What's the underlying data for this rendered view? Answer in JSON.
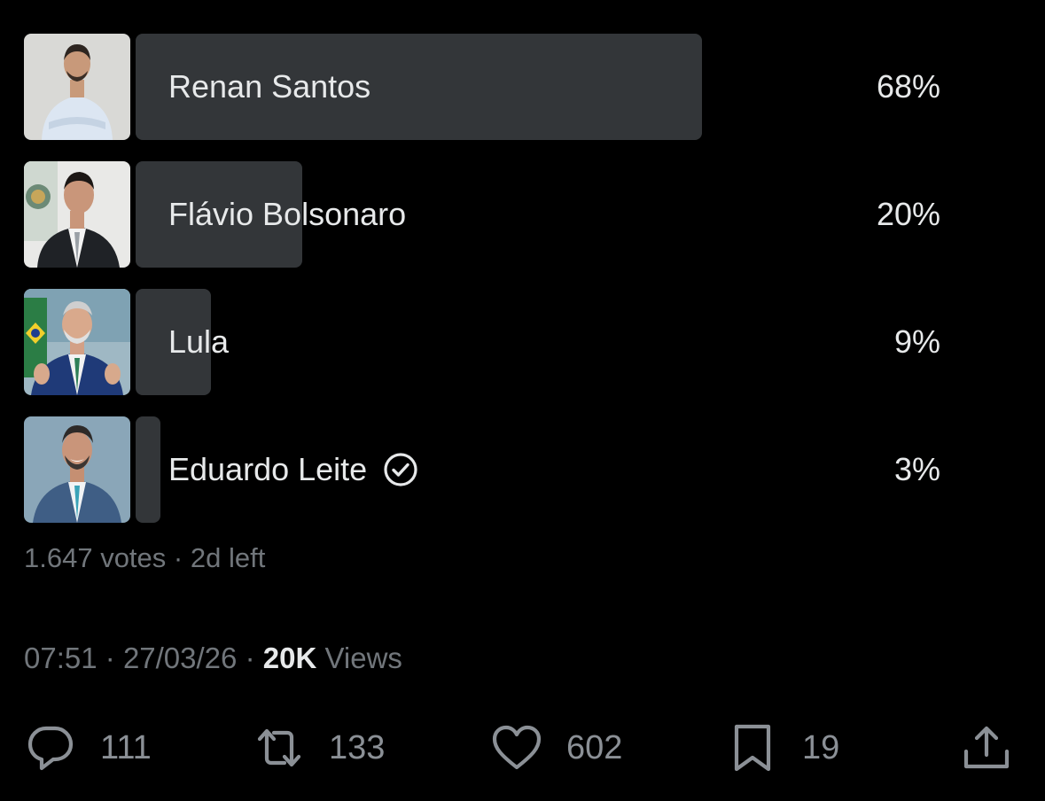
{
  "poll": {
    "options": [
      {
        "label": "Renan Santos",
        "percent_text": "68%",
        "percent": 68,
        "verified": false,
        "avatar": "photo-man-white-shirt"
      },
      {
        "label": "Flávio Bolsonaro",
        "percent_text": "20%",
        "percent": 20,
        "verified": false,
        "avatar": "photo-man-suit-flag"
      },
      {
        "label": "Lula",
        "percent_text": "9%",
        "percent": 9,
        "verified": false,
        "avatar": "photo-man-blue-suit-flag"
      },
      {
        "label": "Eduardo Leite",
        "percent_text": "3%",
        "percent": 3,
        "verified": true,
        "avatar": "photo-man-smiling-suit"
      }
    ],
    "votes": "1.647 votes",
    "separator": "·",
    "time_left": "2d left"
  },
  "tweet_meta": {
    "time": "07:51",
    "date": "27/03/26",
    "views_count": "20K",
    "views_label": "Views",
    "separator": "·"
  },
  "actions": {
    "reply": {
      "icon": "reply-icon",
      "count": "111"
    },
    "repost": {
      "icon": "repost-icon",
      "count": "133"
    },
    "like": {
      "icon": "heart-icon",
      "count": "602"
    },
    "bookmark": {
      "icon": "bookmark-icon",
      "count": "19"
    },
    "share": {
      "icon": "share-icon"
    }
  },
  "colors": {
    "background": "#000000",
    "bar": "#333639",
    "text": "#e7e9ea",
    "muted": "#71767b"
  }
}
